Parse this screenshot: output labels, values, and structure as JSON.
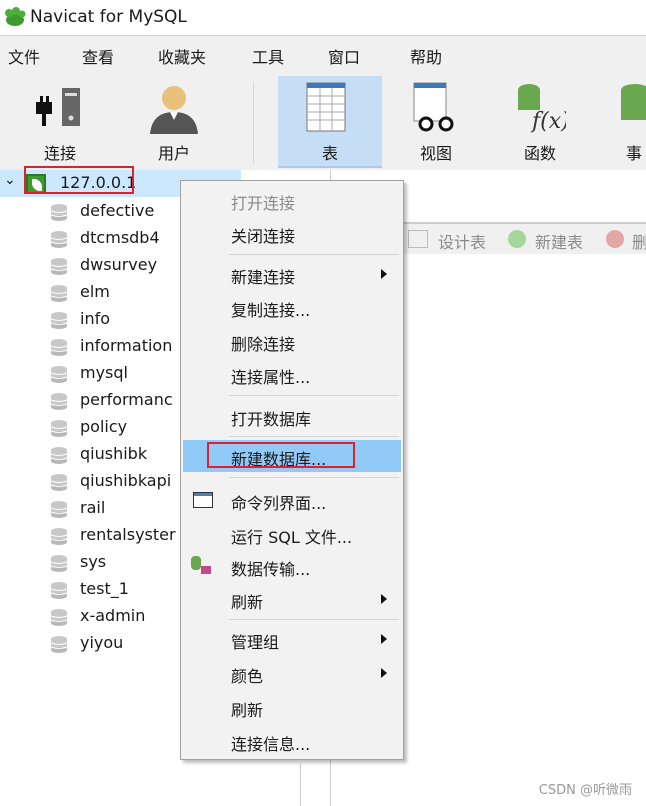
{
  "window": {
    "title": "Navicat for MySQL"
  },
  "menubar": [
    "文件",
    "查看",
    "收藏夹",
    "工具",
    "窗口",
    "帮助"
  ],
  "toolbar": [
    {
      "label": "连接",
      "icon": "connection-icon"
    },
    {
      "label": "用户",
      "icon": "user-icon"
    },
    {
      "label": "表",
      "icon": "table-icon",
      "active": true
    },
    {
      "label": "视图",
      "icon": "view-icon"
    },
    {
      "label": "函数",
      "icon": "function-icon"
    },
    {
      "label": "事",
      "icon": "event-icon"
    }
  ],
  "tree": {
    "connection": "127.0.0.1",
    "databases": [
      "defective",
      "dtcmsdb4",
      "dwsurvey",
      "elm",
      "info",
      "information",
      "mysql",
      "performanc",
      "policy",
      "qiushibk",
      "qiushibkapi",
      "rail",
      "rentalsyster",
      "sys",
      "test_1",
      "x-admin",
      "yiyou"
    ]
  },
  "object_toolbar": [
    "设计表",
    "新建表",
    "删"
  ],
  "context_menu": [
    "打开连接",
    "关闭连接",
    "新建连接",
    "复制连接...",
    "删除连接",
    "连接属性...",
    "打开数据库",
    "新建数据库...",
    "命令列界面...",
    "运行 SQL 文件...",
    "数据传输...",
    "刷新",
    "管理组",
    "颜色",
    "刷新",
    "连接信息..."
  ],
  "watermark": "CSDN @听微雨",
  "colors": {
    "highlight": "#91c9f7",
    "annotation": "#e0202a",
    "selected_row": "#cce8ff"
  }
}
